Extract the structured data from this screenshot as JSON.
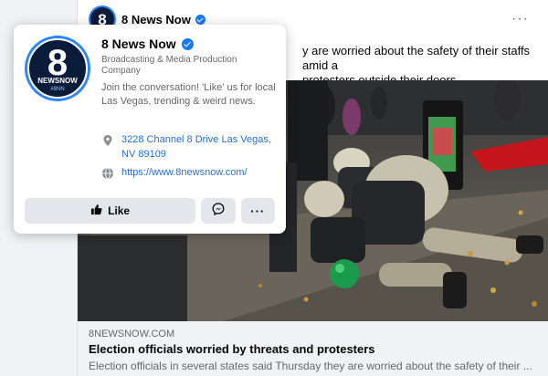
{
  "post": {
    "page_name": "8 News Now",
    "more_label": "···",
    "text_line1": "y are worried about the safety of their staffs amid a",
    "text_line2": "protesters outside their doors.",
    "link": {
      "domain": "8NEWSNOW.COM",
      "title": "Election officials worried by threats and protesters",
      "description": "Election officials in several states said Thursday they are worried about the safety of their ..."
    }
  },
  "hovercard": {
    "name": "8 News Now",
    "category": "Broadcasting & Media Production Company",
    "about": "Join the conversation! 'Like' us for local Las Vegas, trending & weird news.",
    "address": "3228 Channel 8 Drive Las Vegas, NV 89109",
    "website": "https://www.8newsnow.com/",
    "like_label": "Like",
    "more_label": "···",
    "logo": {
      "number": "8",
      "text": "NEWSNOW",
      "hashtag": "#8NN"
    }
  },
  "colors": {
    "accent": "#1877f2",
    "link": "#216fdb",
    "button_bg": "#e4e6eb"
  }
}
